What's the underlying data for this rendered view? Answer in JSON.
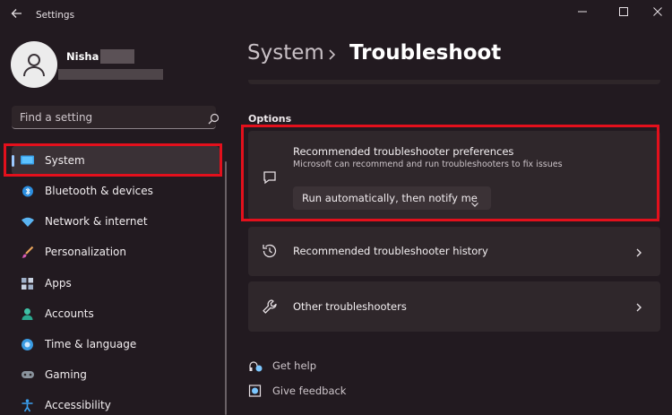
{
  "window": {
    "title": "Settings"
  },
  "profile": {
    "name": "Nisha"
  },
  "search": {
    "placeholder": "Find a setting"
  },
  "sidebar": {
    "items": [
      {
        "label": "System",
        "icon": "system-monitor-icon",
        "selected": true
      },
      {
        "label": "Bluetooth & devices",
        "icon": "bluetooth-icon"
      },
      {
        "label": "Network & internet",
        "icon": "wifi-icon"
      },
      {
        "label": "Personalization",
        "icon": "paintbrush-icon"
      },
      {
        "label": "Apps",
        "icon": "apps-icon"
      },
      {
        "label": "Accounts",
        "icon": "person-icon"
      },
      {
        "label": "Time & language",
        "icon": "globe-clock-icon"
      },
      {
        "label": "Gaming",
        "icon": "gamepad-icon"
      },
      {
        "label": "Accessibility",
        "icon": "accessibility-icon"
      }
    ]
  },
  "breadcrumb": {
    "parent": "System",
    "current": "Troubleshoot"
  },
  "options": {
    "section_title": "Options",
    "preferences": {
      "title": "Recommended troubleshooter preferences",
      "description": "Microsoft can recommend and run troubleshooters to fix issues",
      "dropdown_value": "Run automatically, then notify me",
      "icon": "chat-bubble-icon"
    },
    "history": {
      "title": "Recommended troubleshooter history",
      "icon": "history-icon"
    },
    "other": {
      "title": "Other troubleshooters",
      "icon": "wrench-icon"
    }
  },
  "links": {
    "get_help": "Get help",
    "give_feedback": "Give feedback"
  },
  "colors": {
    "background": "#221a20",
    "card": "#2f272b",
    "accent": "#9cc8ff",
    "highlight_box": "#e3101c"
  }
}
